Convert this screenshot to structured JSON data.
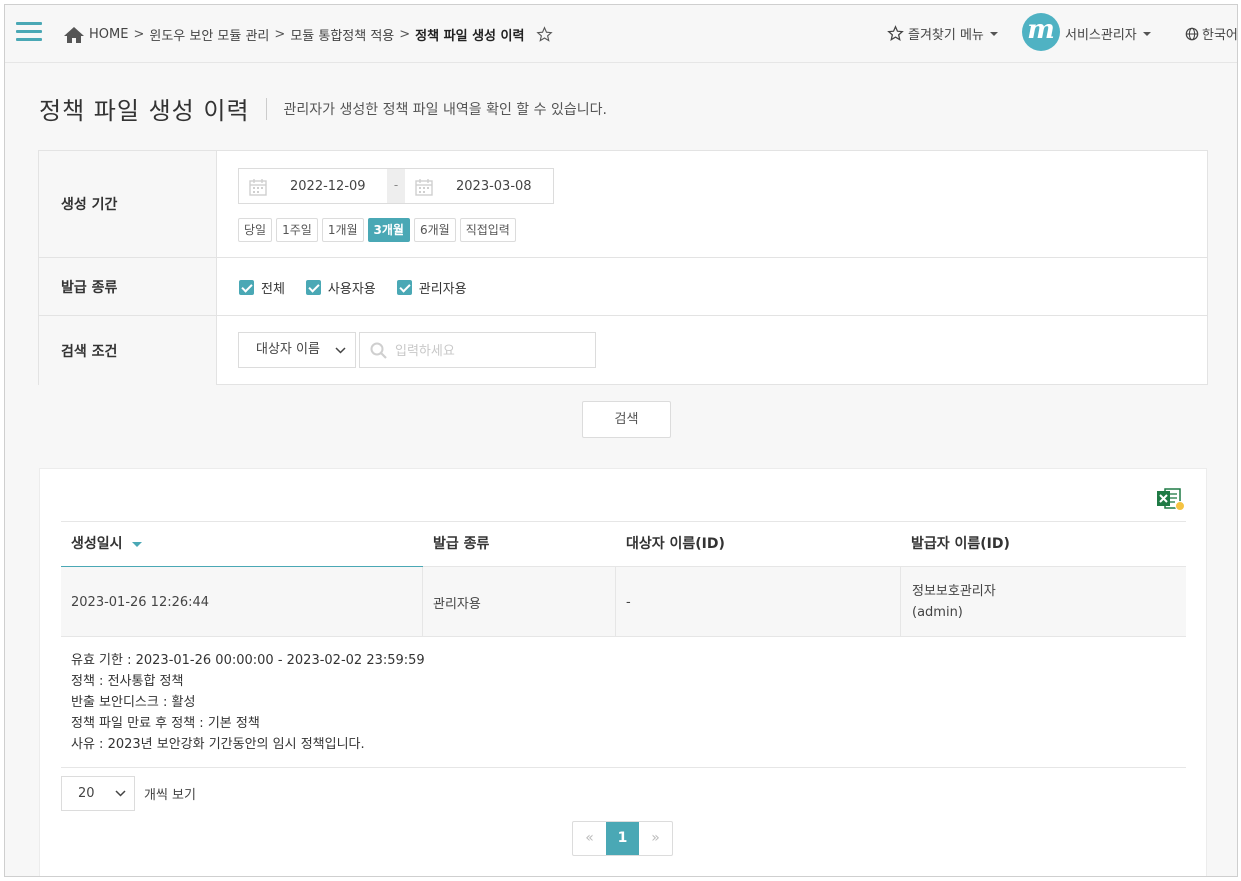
{
  "header": {
    "breadcrumb": [
      "HOME",
      "윈도우 보안 모듈 관리",
      "모듈 통합정책 적용",
      "정책 파일 생성 이력"
    ],
    "favorites_label": "즐겨찾기 메뉴",
    "avatar_letter": "m",
    "user_label": "서비스관리자",
    "language_label": "한국어"
  },
  "page": {
    "title": "정책 파일 생성 이력",
    "description": "관리자가 생성한 정책 파일 내역을 확인 할 수 있습니다."
  },
  "filters": {
    "period_label": "생성 기간",
    "date_from": "2022-12-09",
    "date_sep": "-",
    "date_to": "2023-03-08",
    "period_buttons": [
      "당일",
      "1주일",
      "1개월",
      "3개월",
      "6개월",
      "직접입력"
    ],
    "period_active": "3개월",
    "issue_type_label": "발급 종류",
    "issue_types": [
      {
        "label": "전체",
        "checked": true
      },
      {
        "label": "사용자용",
        "checked": true
      },
      {
        "label": "관리자용",
        "checked": true
      }
    ],
    "condition_label": "검색 조건",
    "condition_select": "대상자 이름",
    "search_placeholder": "입력하세요",
    "search_button": "검색"
  },
  "table": {
    "columns": [
      "생성일시",
      "발급 종류",
      "대상자 이름(ID)",
      "발급자 이름(ID)"
    ],
    "rows": [
      {
        "created_at": "2023-01-26 12:26:44",
        "issue_type": "관리자용",
        "target": "-",
        "issuer_name": "정보보호관리자",
        "issuer_id": "(admin)"
      }
    ],
    "detail_lines": [
      "유효 기한 : 2023-01-26 00:00:00 - 2023-02-02 23:59:59",
      "정책 : 전사통합 정책",
      "반출 보안디스크 : 활성",
      "정책 파일 만료 후 정책 : 기본 정책",
      "사유 : 2023년 보안강화 기간동안의 임시 정책입니다."
    ]
  },
  "pagination": {
    "page_size": "20",
    "page_size_suffix": "개씩 보기",
    "prev": "«",
    "current": "1",
    "next": "»"
  },
  "colors": {
    "accent": "#4aa8b5",
    "excel_green": "#1f7a45"
  }
}
